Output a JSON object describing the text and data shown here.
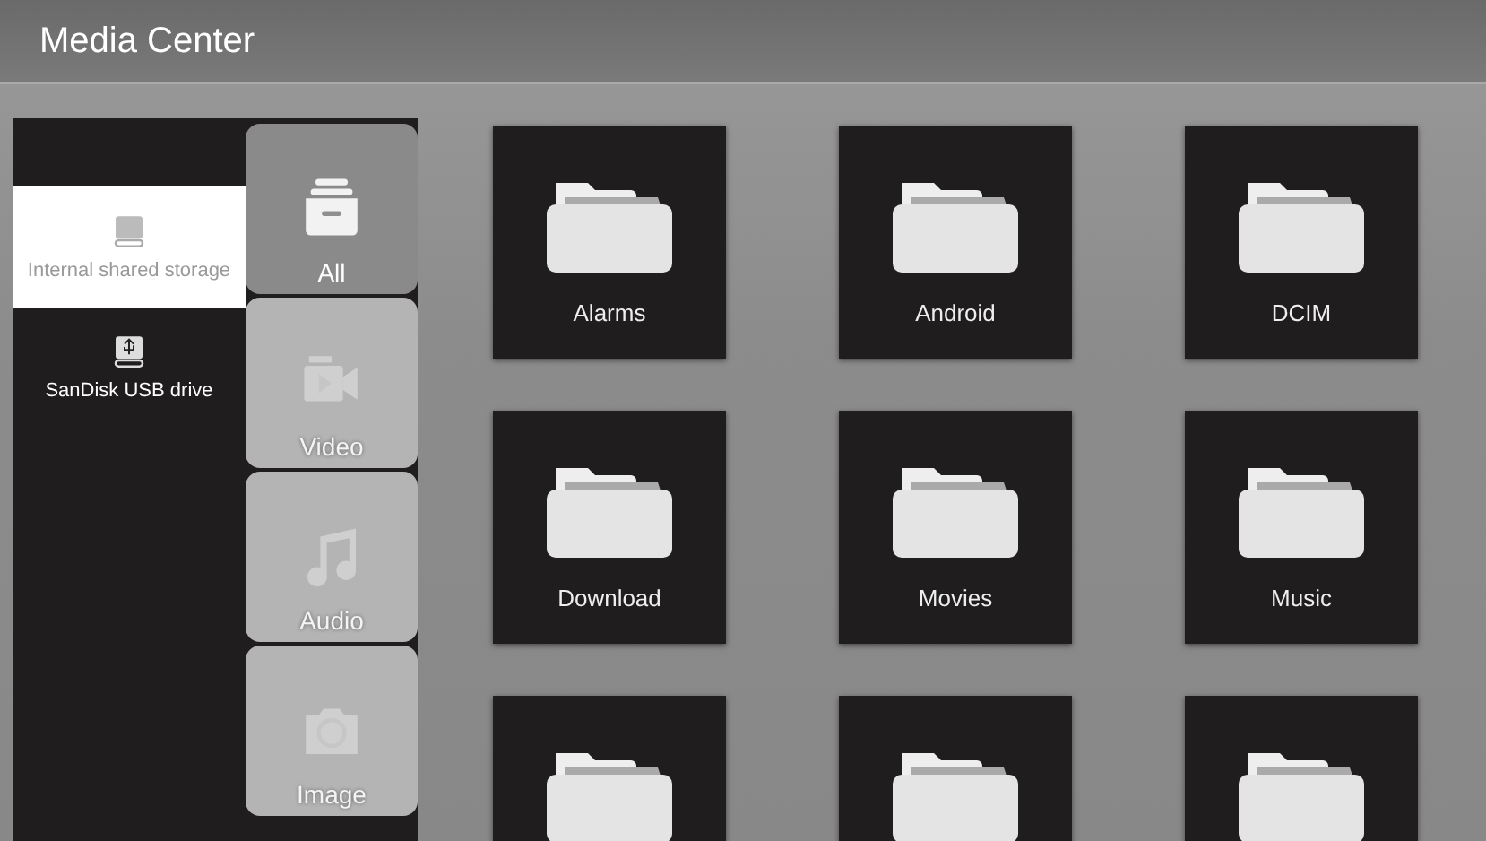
{
  "window": {
    "title": "Media Center"
  },
  "storage": [
    {
      "label": "Internal shared storage",
      "kind": "internal",
      "selected": true
    },
    {
      "label": "SanDisk USB drive",
      "kind": "usb",
      "selected": false
    }
  ],
  "categories": [
    {
      "label": "All",
      "kind": "all",
      "selected": true
    },
    {
      "label": "Video",
      "kind": "video",
      "selected": false
    },
    {
      "label": "Audio",
      "kind": "audio",
      "selected": false
    },
    {
      "label": "Image",
      "kind": "image",
      "selected": false
    }
  ],
  "folders": [
    {
      "kind": "labeled",
      "name": "Alarms"
    },
    {
      "kind": "labeled",
      "name": "Android"
    },
    {
      "kind": "labeled",
      "name": "DCIM"
    },
    {
      "kind": "labeled",
      "name": "Download"
    },
    {
      "kind": "labeled",
      "name": "Movies"
    },
    {
      "kind": "labeled",
      "name": "Music"
    },
    {
      "kind": "unlabeled"
    },
    {
      "kind": "unlabeled"
    },
    {
      "kind": "unlabeled"
    }
  ]
}
